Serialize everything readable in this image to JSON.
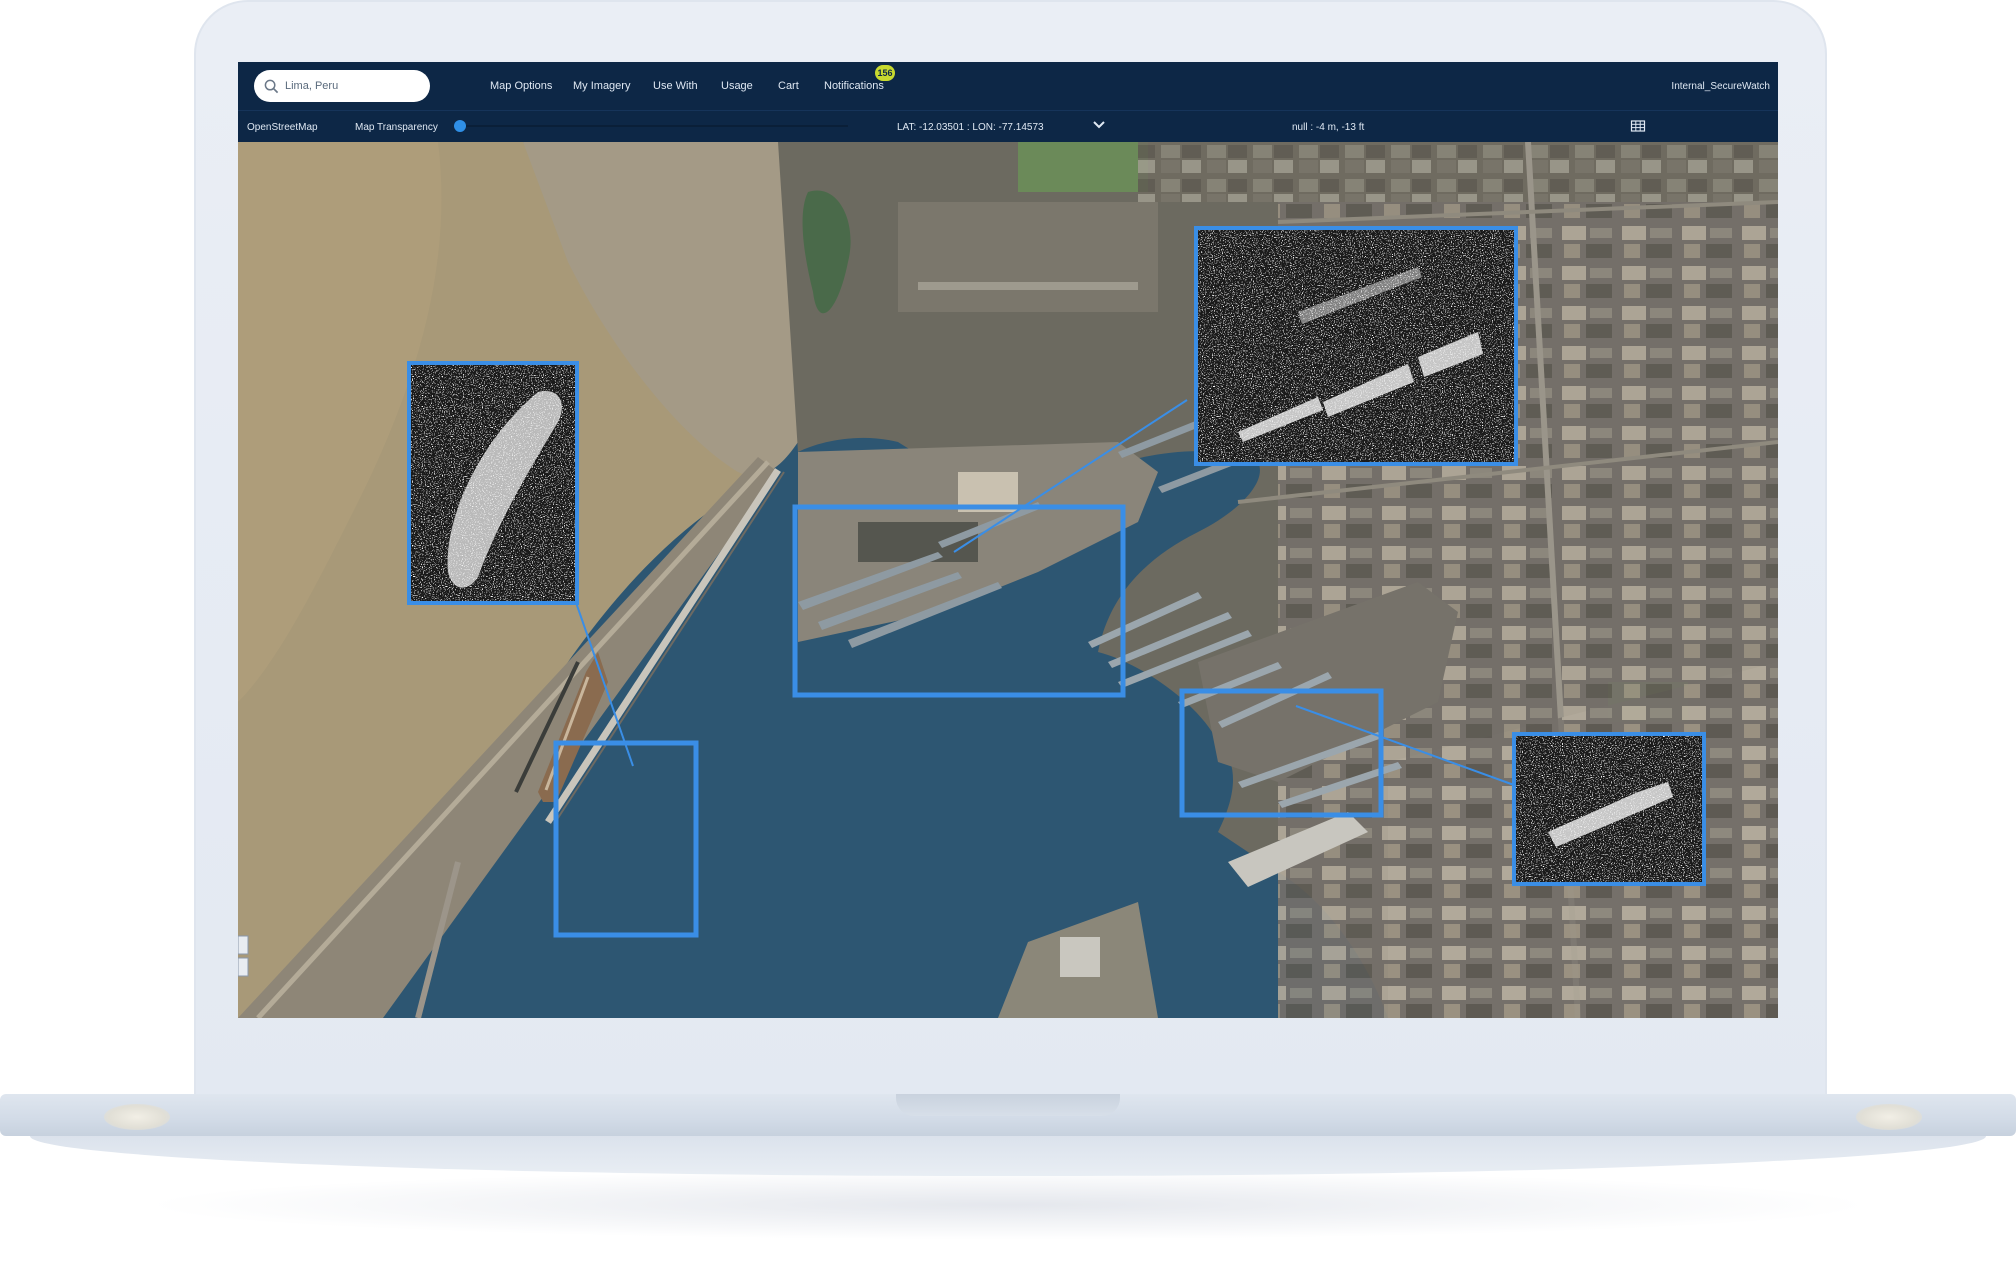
{
  "search": {
    "value": "Lima, Peru",
    "icon": "search-icon"
  },
  "nav": {
    "items": [
      {
        "label": "Map Options"
      },
      {
        "label": "My Imagery"
      },
      {
        "label": "Use With"
      },
      {
        "label": "Usage"
      },
      {
        "label": "Cart"
      },
      {
        "label": "Notifications"
      }
    ],
    "notifications_count": "156"
  },
  "user": {
    "name": "Internal_SecureWatch"
  },
  "toolbar": {
    "basemap": "OpenStreetMap",
    "transparency_label": "Map Transparency",
    "transparency_value": 0,
    "coordinates": "LAT: -12.03501 : LON: -77.14573",
    "elevation": "null : -4 m, -13 ft",
    "grid_icon": "grid-icon",
    "dropdown_icon": "chevron-down-icon"
  },
  "colors": {
    "topbar": "#0d2746",
    "accent": "#2f8fe6",
    "highlight_box": "#3a8ee6",
    "badge": "#c7d92f",
    "sea": "#2d5672",
    "shallow_water": "#a89978",
    "land": "#6a6a5e"
  },
  "map": {
    "type": "satellite-imagery",
    "highlight_boxes": 3,
    "sar_insets": 4
  }
}
